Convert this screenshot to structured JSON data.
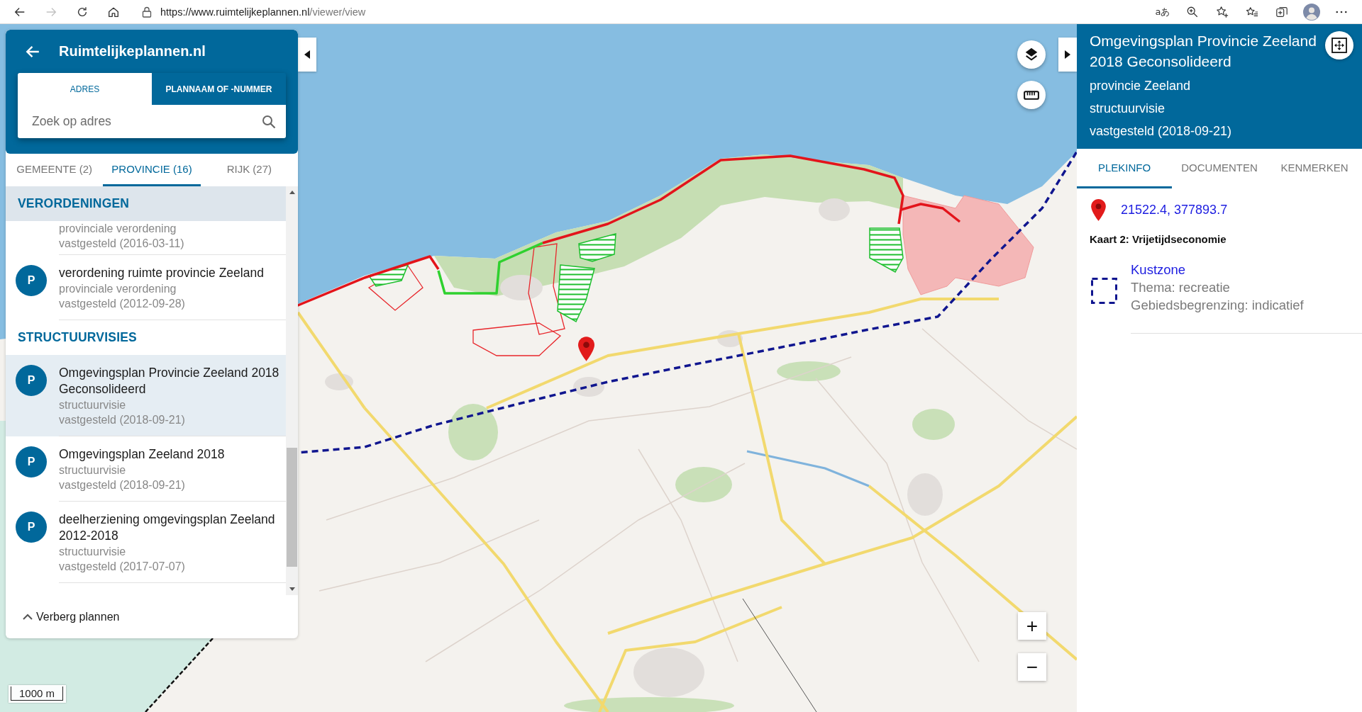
{
  "browser": {
    "url_host": "https://www.ruimtelijkeplannen.nl",
    "url_path": "/viewer/view",
    "forward_disabled": true,
    "translate_glyph": "aあ"
  },
  "left_panel": {
    "title": "Ruimtelijkeplannen.nl",
    "search_tabs": [
      {
        "label": "ADRES",
        "selected": true
      },
      {
        "label": "PLANNAAM OF -NUMMER",
        "selected": false
      }
    ],
    "search": {
      "placeholder": "Zoek op adres"
    },
    "level_tabs": [
      {
        "label": "GEMEENTE (2)",
        "selected": false
      },
      {
        "label": "PROVINCIE (16)",
        "selected": true
      },
      {
        "label": "RIJK (27)",
        "selected": false
      }
    ],
    "sections": [
      {
        "heading": "VERORDENINGEN",
        "stuck": true,
        "items": [
          {
            "type": "provinciale verordening",
            "status": "vastgesteld (2016-03-11)",
            "selected": false
          },
          {
            "badge": "P",
            "title": "verordening ruimte provincie Zeeland",
            "type": "provinciale verordening",
            "status": "vastgesteld (2012-09-28)",
            "selected": false
          }
        ]
      },
      {
        "heading": "STRUCTUURVISIES",
        "stuck": false,
        "items": [
          {
            "badge": "P",
            "title": "Omgevingsplan Provincie Zeeland 2018 Geconsolideerd",
            "type": "structuurvisie",
            "status": "vastgesteld (2018-09-21)",
            "selected": true
          },
          {
            "badge": "P",
            "title": "Omgevingsplan Zeeland 2018",
            "type": "structuurvisie",
            "status": "vastgesteld (2018-09-21)",
            "selected": false
          },
          {
            "badge": "P",
            "title": "deelherziening omgevingsplan Zeeland 2012-2018",
            "type": "structuurvisie",
            "status": "vastgesteld (2017-07-07)",
            "selected": false
          }
        ]
      }
    ],
    "toggle": {
      "label": "Verberg plannen"
    }
  },
  "map": {
    "scale_label": "1000 m",
    "zoom_in": "+",
    "zoom_out": "−"
  },
  "right_panel": {
    "title": "Omgevingsplan Provincie Zeeland 2018 Geconsolideerd",
    "subtitle_lines": [
      "provincie Zeeland",
      "structuurvisie",
      "vastgesteld (2018-09-21)"
    ],
    "tabs": [
      {
        "label": "PLEKINFO",
        "selected": true
      },
      {
        "label": "DOCUMENTEN",
        "selected": false
      },
      {
        "label": "KENMERKEN",
        "selected": false
      }
    ],
    "coordinates": "21522.4, 377893.7",
    "map_title": "Kaart 2: Vrijetijdseconomie",
    "legend": [
      {
        "name": "Kustzone",
        "lines": [
          "Thema: recreatie",
          "Gebiedsbegrenzing: indicatief"
        ]
      }
    ]
  }
}
